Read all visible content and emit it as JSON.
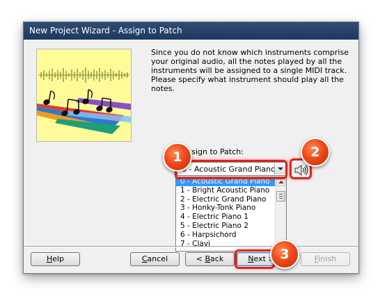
{
  "window": {
    "title": "New Project Wizard - Assign to Patch"
  },
  "description": "Since you do not know which instruments comprise your original audio, all the notes played by all the instruments will be assigned to a single MIDI track. Please specify what instrument should play all the notes.",
  "assign": {
    "label": "Assign to Patch:",
    "selected": "0 - Acoustic Grand Piano",
    "options": [
      "0 - Acoustic Grand Piano",
      "1 - Bright Acoustic Piano",
      "2 - Electric Grand Piano",
      "3 - Honky-Tonk Piano",
      "4 - Electric Piano 1",
      "5 - Electric Piano 2",
      "6 - Harpsichord",
      "7 - Clavi"
    ]
  },
  "icons": {
    "preview": "speaker-icon",
    "illustration": "music-notes-waveform"
  },
  "buttons": {
    "help": {
      "pre": "",
      "mnemonic": "H",
      "post": "elp"
    },
    "cancel": {
      "pre": "",
      "mnemonic": "C",
      "post": "ancel"
    },
    "back": {
      "pre": "< ",
      "mnemonic": "B",
      "post": "ack"
    },
    "next": {
      "pre": "",
      "mnemonic": "N",
      "post": "ext >"
    },
    "finish": {
      "pre": "",
      "mnemonic": "F",
      "post": "inish"
    }
  },
  "callouts": [
    "1",
    "2",
    "3"
  ],
  "colors": {
    "titlebar": "#1d3961",
    "highlight": "#e0221b",
    "badge": "#ee4a1a",
    "selection": "#3399ff",
    "art_bg": "#fffb99"
  }
}
